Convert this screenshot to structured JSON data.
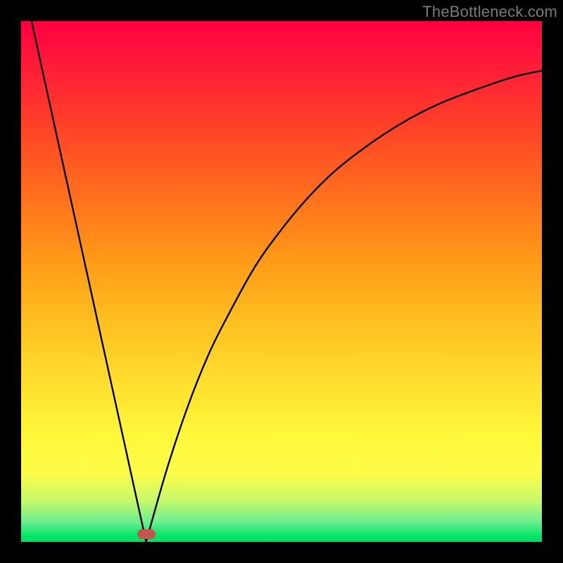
{
  "watermark": "TheBottleneck.com",
  "colors": {
    "frame": "#000000",
    "curve": "#000000",
    "marker": "#c4554d",
    "watermark": "#7a7a7a"
  },
  "chart_data": {
    "type": "line",
    "title": "",
    "xlabel": "",
    "ylabel": "",
    "xlim": [
      0,
      100
    ],
    "ylim": [
      0,
      100
    ],
    "grid": false,
    "legend": false,
    "annotations": [
      {
        "type": "marker",
        "x": 24,
        "y": 1.5
      }
    ],
    "series": [
      {
        "name": "left-slope",
        "x": [
          2,
          24
        ],
        "values": [
          100,
          0
        ]
      },
      {
        "name": "right-curve",
        "x": [
          24,
          28,
          32,
          36,
          40,
          45,
          50,
          55,
          60,
          65,
          70,
          75,
          80,
          85,
          90,
          95,
          100
        ],
        "values": [
          0,
          14,
          26,
          36,
          44,
          53,
          60,
          66,
          71,
          75,
          78.5,
          81.5,
          84,
          86,
          87.8,
          89.4,
          90.5
        ]
      }
    ]
  }
}
